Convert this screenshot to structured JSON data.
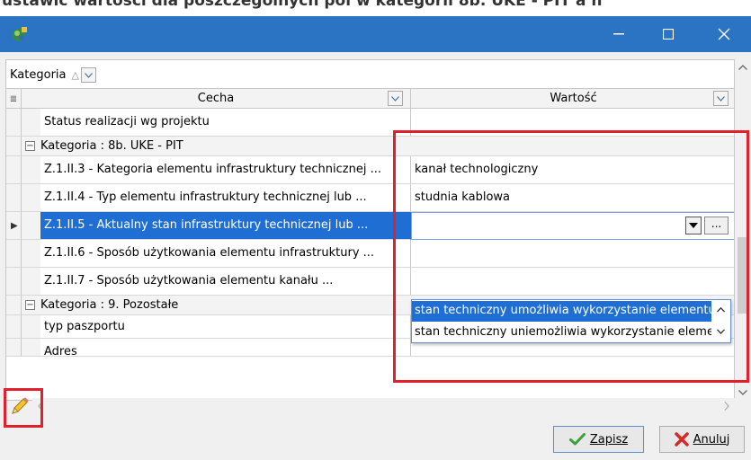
{
  "top_text": "ustawić wartości dla poszczególnych pól w kategorii 8b. UKE - PIT a n",
  "window": {
    "app_icon": "app-icon",
    "minimize_icon": "minimize-icon",
    "maximize_icon": "maximize-icon",
    "close_icon": "close-icon"
  },
  "grouping": {
    "label": "Kategoria",
    "sort_icon": "sort-ascending-icon"
  },
  "grid": {
    "columns": [
      "Cecha",
      "Wartość"
    ],
    "rows": [
      {
        "type": "data",
        "cecha": "Status realizacji wg projektu",
        "wartosc": ""
      },
      {
        "type": "group",
        "label": "Kategoria : 8b. UKE - PIT"
      },
      {
        "type": "data",
        "cecha": "Z.1.II.3 - Kategoria elementu infrastruktury technicznej ...",
        "wartosc": "kanał technologiczny"
      },
      {
        "type": "data",
        "cecha": "Z.1.II.4 - Typ elementu infrastruktury technicznej lub ...",
        "wartosc": "studnia kablowa"
      },
      {
        "type": "data",
        "cecha": "Z.1.II.5 - Aktualny stan infrastruktury technicznej lub ...",
        "wartosc": "",
        "selected": true
      },
      {
        "type": "data",
        "cecha": "Z.1.II.6 - Sposób użytkowania elementu infrastruktury ...",
        "wartosc": ""
      },
      {
        "type": "data",
        "cecha": "Z.1.II.7 - Sposób użytkowania elementu kanału ...",
        "wartosc": ""
      },
      {
        "type": "group",
        "label": "Kategoria : 9. Pozostałe"
      },
      {
        "type": "data",
        "cecha": "typ paszportu",
        "wartosc": ""
      },
      {
        "type": "data",
        "cecha": "Adres",
        "wartosc": ""
      }
    ],
    "editor_button_label": "..."
  },
  "dropdown": {
    "options": [
      "stan techniczny umożliwia wykorzystanie elementu",
      "stan techniczny uniemożliwia wykorzystanie elementu"
    ],
    "selected_index": 0
  },
  "buttons": {
    "save_label": "Zapisz",
    "cancel_label": "Anuluj",
    "save_icon": "checkmark-icon",
    "cancel_icon": "x-icon"
  },
  "highlight_color": "#e0202a",
  "selection_color": "#1f6ed4"
}
